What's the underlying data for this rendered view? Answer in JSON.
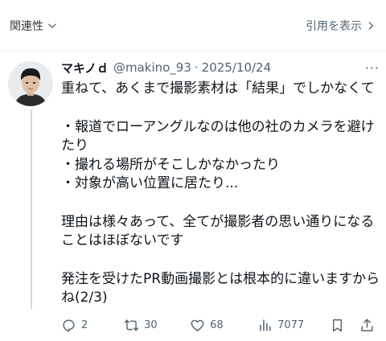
{
  "topbar": {
    "related_label": "関連性",
    "quote_label": "引用を表示"
  },
  "tweet": {
    "display_name": "マキノｄ",
    "handle": "@makino_93",
    "separator": "·",
    "date": "2025/10/24",
    "more": "···",
    "lines": [
      "重ねて、あくまで撮影素材は「結果」でしかなくて",
      "",
      "・報道でローアングルなのは他の社のカメラを避けたり",
      "・撮れる場所がそこしかなかったり",
      "・対象が高い位置に居たり...",
      "",
      "理由は様々あって、全てが撮影者の思い通りになることはほぼないです",
      "",
      "発注を受けたPR動画撮影とは根本的に違いますからね(2/3)"
    ]
  },
  "actions": {
    "replies": "2",
    "retweets": "30",
    "likes": "68",
    "views": "7077"
  },
  "icons": {
    "chevron_down": "chevron-down-icon",
    "chevron_right": "chevron-right-icon",
    "reply": "reply-icon",
    "retweet": "retweet-icon",
    "like": "heart-icon",
    "views": "views-icon",
    "bookmark": "bookmark-icon",
    "share": "share-icon"
  }
}
